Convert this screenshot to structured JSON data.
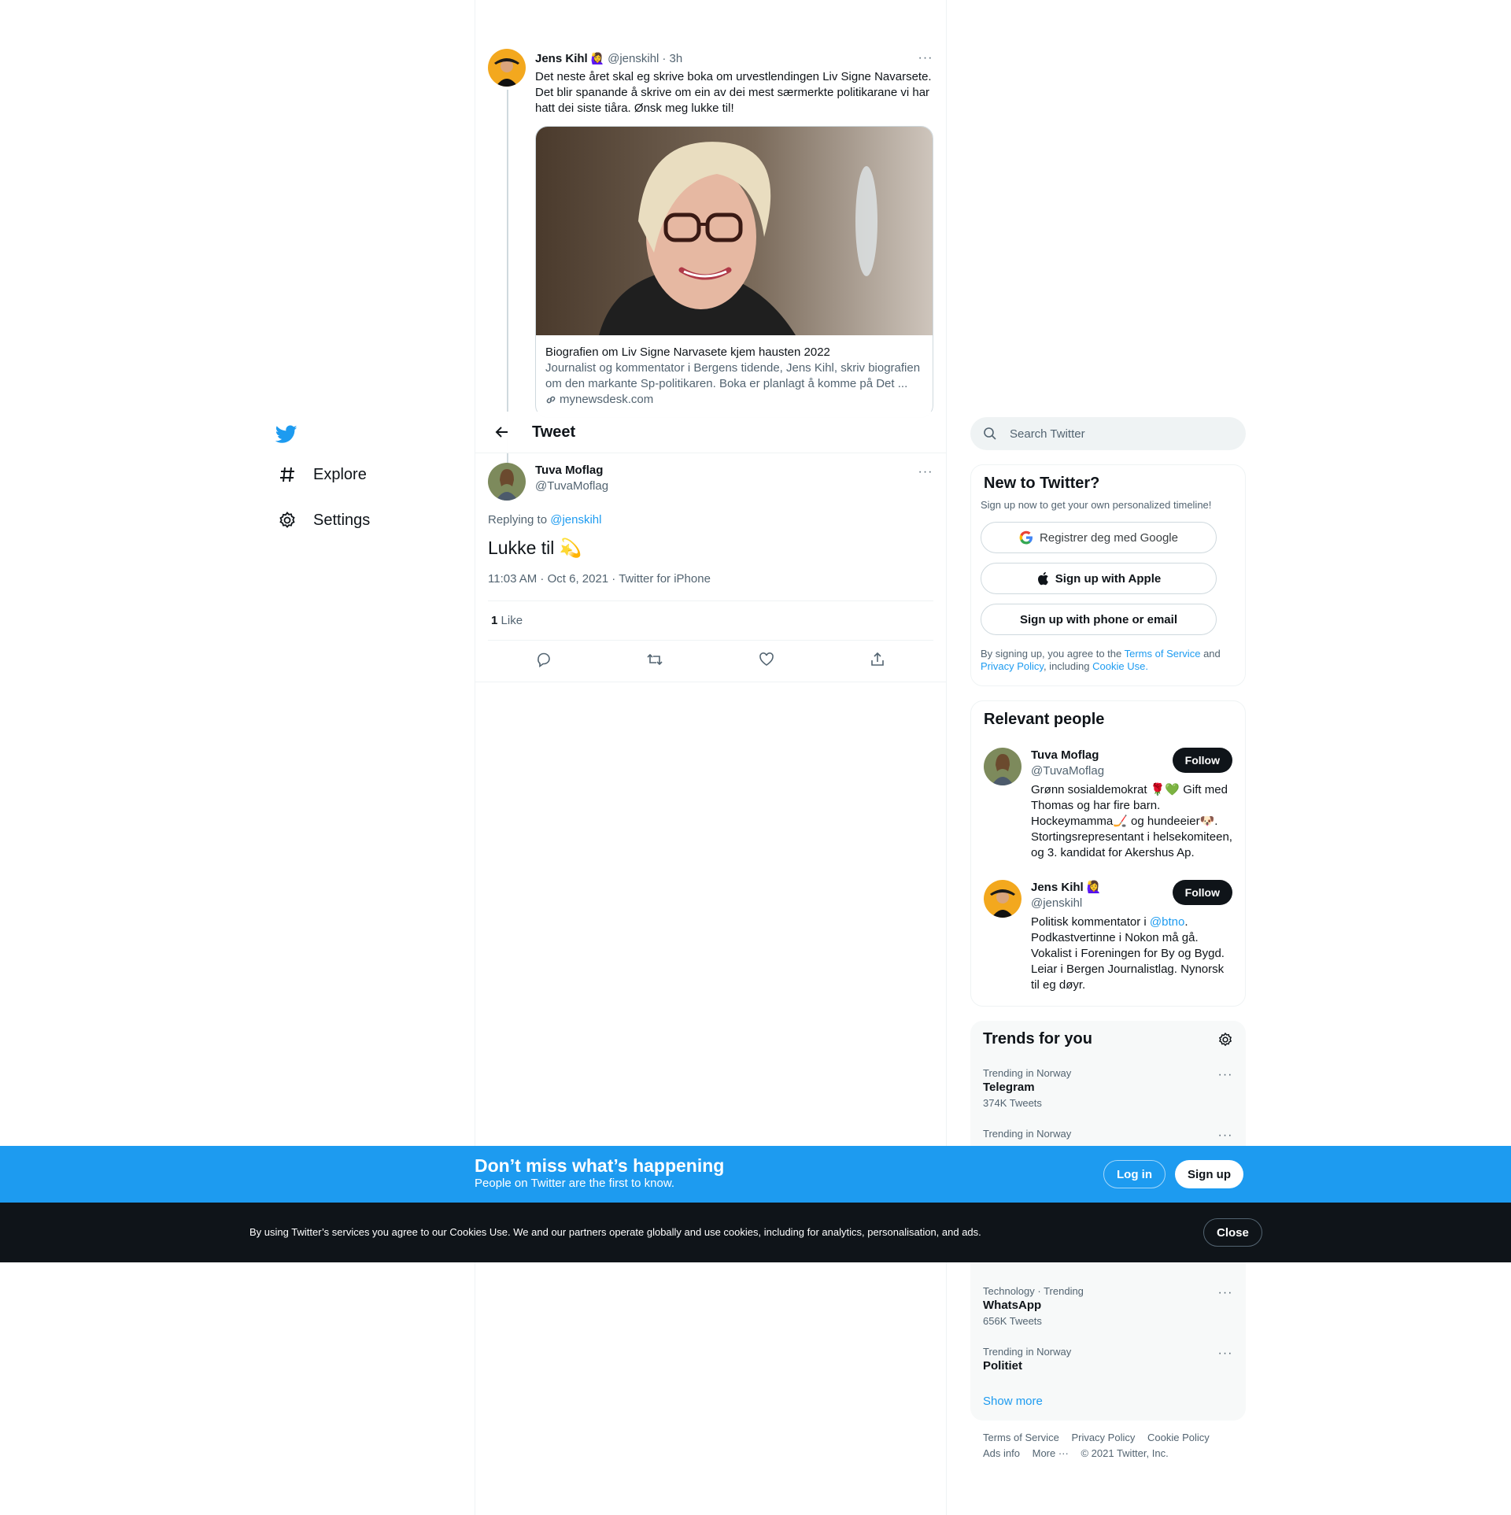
{
  "nav": {
    "explore": "Explore",
    "settings": "Settings"
  },
  "parent_tweet": {
    "name": "Jens Kihl",
    "name_emoji": "🙋‍♀️",
    "handle": "@jenskihl",
    "time": "· 3h",
    "text": "Det neste året skal eg skrive boka om urvestlendingen Liv Signe Navarsete. Det blir spanande å skrive om ein av dei mest særmerkte politikarane vi har hatt dei siste tiåra. Ønsk meg lukke til!",
    "card": {
      "title": "Biografien om Liv Signe Narvasete kjem hausten 2022",
      "description": "Journalist og kommentator i Bergens tidende, Jens Kihl, skriv biografien om den markante Sp-politikaren. Boka er planlagt å komme på Det ...",
      "domain": "mynewsdesk.com"
    }
  },
  "header": {
    "title": "Tweet"
  },
  "tweet": {
    "name": "Tuva Moflag",
    "handle": "@TuvaMoflag",
    "replying_prefix": "Replying to",
    "replying_to": "@jenskihl",
    "text": "Lukke til 💫",
    "meta": "11:03 AM · Oct 6, 2021 · Twitter for iPhone",
    "like_count": "1",
    "like_label": "Like"
  },
  "sidebar": {
    "search_placeholder": "Search Twitter",
    "new_to_twitter": {
      "title": "New to Twitter?",
      "subtitle": "Sign up now to get your own personalized timeline!",
      "google": "Registrer deg med Google",
      "apple": "Sign up with Apple",
      "phone": "Sign up with phone or email",
      "terms_prefix": "By signing up, you agree to the",
      "terms_link": "Terms of Service",
      "and": "and",
      "privacy_link": "Privacy Policy",
      "including": ", including",
      "cookie_link": "Cookie Use."
    },
    "relevant": {
      "title": "Relevant people",
      "people": [
        {
          "name": "Tuva Moflag",
          "handle": "@TuvaMoflag",
          "follow": "Follow",
          "bio": "Grønn sosialdemokrat 🌹💚 Gift med Thomas og har fire barn. Hockeymamma🏒 og hundeeier🐶. Stortingsrepresentant i helsekomiteen, og 3. kandidat for Akershus Ap."
        },
        {
          "name": "Jens Kihl 🙋‍♀️",
          "handle": "@jenskihl",
          "follow": "Follow",
          "bio_prefix": "Politisk kommentator i",
          "bio_link": "@btno",
          "bio_rest": ". Podkastvertinne i Nokon må gå. Vokalist i Foreningen for By og Bygd. Leiar i Bergen Journalistlag. Nynorsk til eg døyr."
        }
      ]
    },
    "trends": {
      "title": "Trends for you",
      "items": [
        {
          "context": "Trending in Norway",
          "name": "Telegram",
          "count": "374K Tweets"
        },
        {
          "context": "Trending in Norway",
          "name": "",
          "count": ""
        },
        {
          "context": "Technology · Trending",
          "name": "WhatsApp",
          "count": "656K Tweets"
        },
        {
          "context": "Trending in Norway",
          "name": "Politiet",
          "count": ""
        }
      ],
      "show_more": "Show more"
    },
    "footer": {
      "links": [
        "Terms of Service",
        "Privacy Policy",
        "Cookie Policy",
        "Ads info",
        "More ···",
        "© 2021 Twitter, Inc."
      ]
    }
  },
  "signup_bar": {
    "title": "Don’t miss what’s happening",
    "subtitle": "People on Twitter are the first to know.",
    "login": "Log in",
    "signup": "Sign up"
  },
  "cookie_bar": {
    "text": "By using Twitter’s services you agree to our Cookies Use. We and our partners operate globally and use cookies, including for analytics, personalisation, and ads.",
    "close": "Close"
  },
  "colors": {
    "accent": "#1d9bf0",
    "text": "#0f1419",
    "muted": "#536471"
  }
}
